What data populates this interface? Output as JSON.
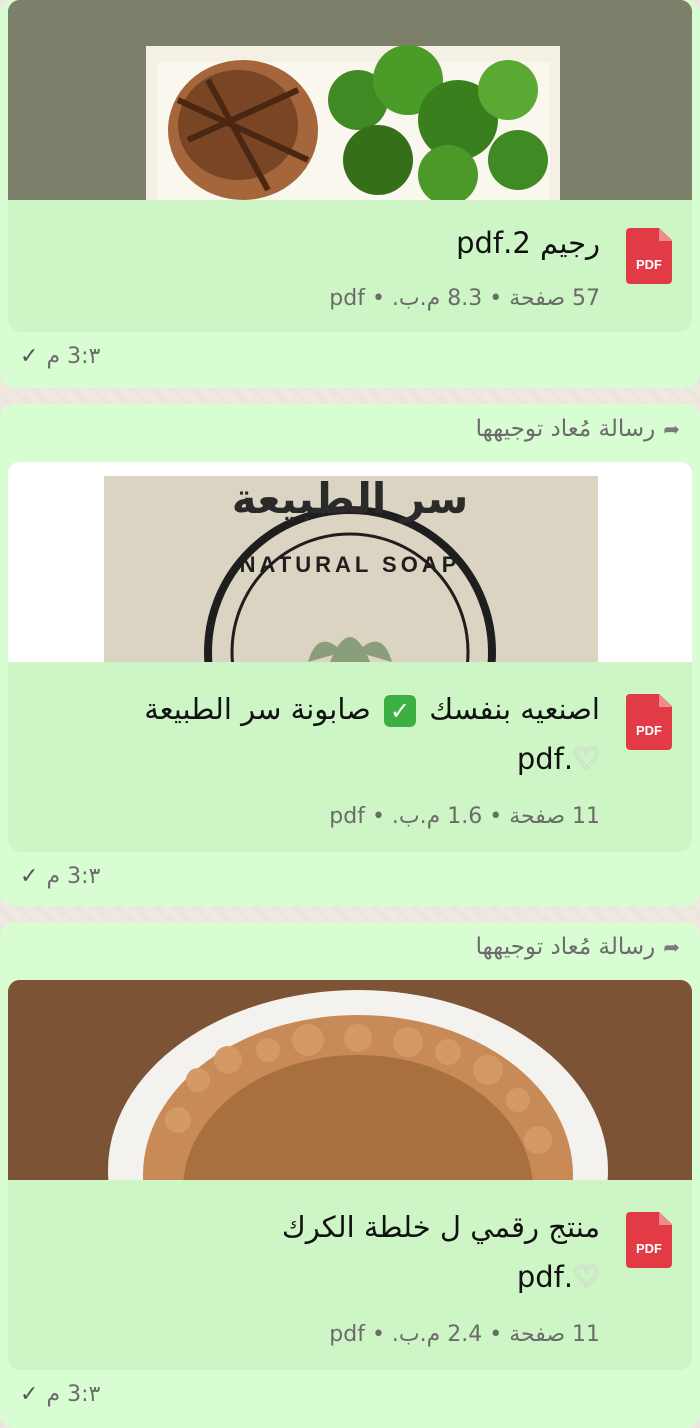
{
  "messages": [
    {
      "filename": "رجيم  2.pdf",
      "meta": "57 صفحة • 8.3 م.ب. • pdf",
      "time": "٣:3 م",
      "icon_label": "PDF"
    },
    {
      "forwarded_label": "رسالة مُعاد توجيهها",
      "thumb_title": "سر الطبيعة",
      "thumb_ring_text": "NATURAL SOAP",
      "filename_part1": "اصنعيه بنفسك",
      "filename_part2": "صابونة سر الطبيعة",
      "filename_line2": ".pdf",
      "meta": "11 صفحة • 1.6 م.ب. • pdf",
      "time": "٣:3 م",
      "icon_label": "PDF"
    },
    {
      "forwarded_label": "رسالة مُعاد توجيهها",
      "filename_line1": "منتج رقمي ل خلطة الكرك",
      "filename_line2": ".pdf",
      "meta": "11 صفحة • 2.4 م.ب. • pdf",
      "time": "٣:3 م",
      "icon_label": "PDF"
    }
  ],
  "icons": {
    "checkmark": "✓",
    "forward": "➦",
    "check_emoji": "✓",
    "heart_emoji": "♡"
  },
  "colors": {
    "bubble_bg": "#d9fdd3",
    "pdf_red": "#e23b45"
  }
}
